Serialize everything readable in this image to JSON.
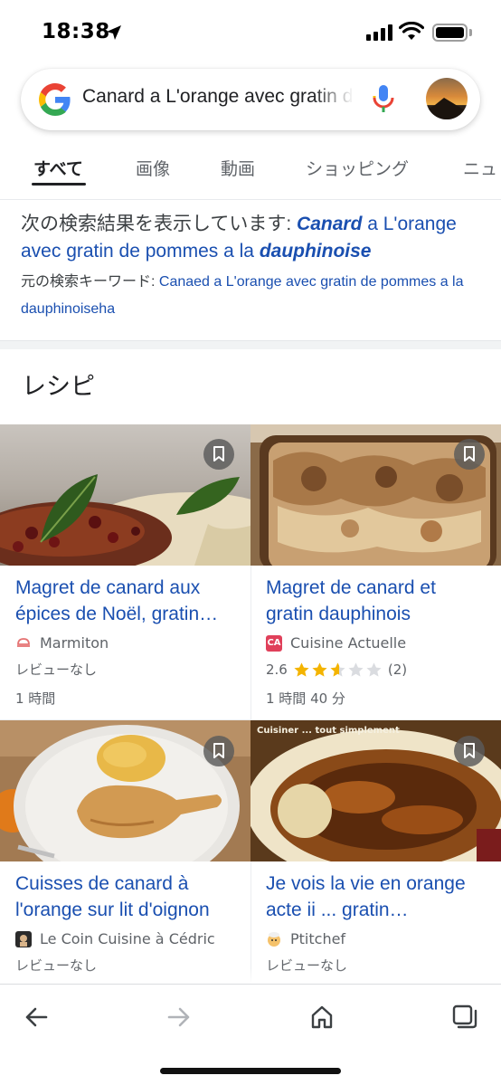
{
  "status_bar": {
    "time": "18:38"
  },
  "search": {
    "query": "Canard a L'orange avec gratin de pommes a la dauphinoise"
  },
  "tabs": [
    "すべて",
    "画像",
    "動画",
    "ショッピング",
    "ニュ"
  ],
  "spell_correction": {
    "prefix": "次の検索結果を表示しています: ",
    "corrected_part1_bi": "Canard",
    "corrected_part2": " a L'orange avec gratin de pommes a la ",
    "corrected_part3_bi": "dauphinoise",
    "original_prefix": "元の検索キーワード: ",
    "original_query": "Canaed a L'orange avec gratin de pommes a la dauphinoiseha"
  },
  "recipes": {
    "title": "レシピ",
    "items": [
      {
        "title": "Magret de canard aux épices de Noël, gratin…",
        "source": "Marmiton",
        "reviews": "レビューなし",
        "time": "1 時間"
      },
      {
        "title": "Magret de canard et gratin dauphinois",
        "source": "Cuisine Actuelle",
        "rating": "2.6",
        "rating_value": 2.6,
        "rating_count": "(2)",
        "time": "1 時間 40 分"
      },
      {
        "title": "Cuisses de canard à l'orange sur lit d'oignon",
        "source": "Le Coin Cuisine à Cédric",
        "reviews": "レビューなし"
      },
      {
        "title": "Je vois la vie en orange acte ii ... gratin…",
        "source": "Ptitchef",
        "reviews": "レビューなし",
        "image_caption": "Cuisiner ... tout simplement"
      }
    ]
  },
  "source_icons": {
    "cuisine_actuelle": "CA"
  },
  "colors": {
    "link": "#1a4fb0",
    "accent_star": "#f4b400",
    "tab_active": "#202124"
  },
  "icons": [
    "location-arrow-icon",
    "signal-icon",
    "wifi-icon",
    "battery-icon",
    "google-logo-icon",
    "microphone-icon",
    "bookmark-icon",
    "back-arrow-icon",
    "forward-arrow-icon",
    "home-icon",
    "tabs-icon"
  ]
}
